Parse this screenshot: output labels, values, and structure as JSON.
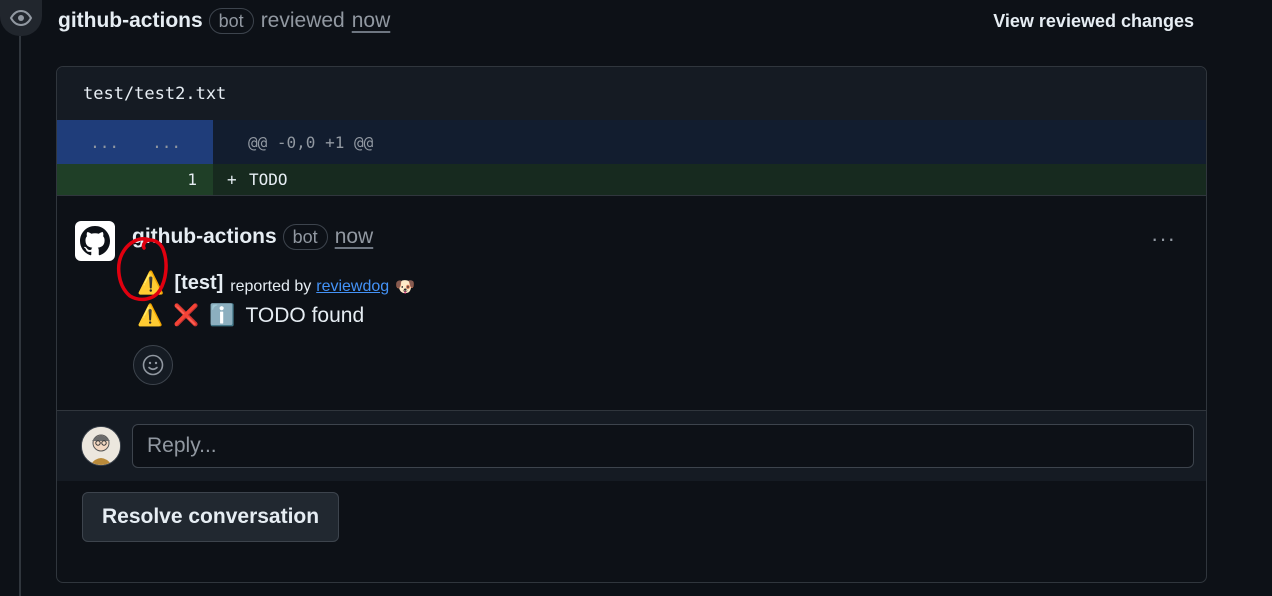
{
  "review_header": {
    "author": "github-actions",
    "badge": "bot",
    "action": "reviewed",
    "timestamp": "now",
    "view_changes_label": "View reviewed changes"
  },
  "file": {
    "path": "test/test2.txt",
    "hunk": {
      "left_num": "...",
      "right_num": "...",
      "text": "@@ -0,0 +1 @@"
    },
    "added_line": {
      "number": "1",
      "sign": "+",
      "text": "TODO"
    }
  },
  "comment": {
    "author": "github-actions",
    "badge": "bot",
    "timestamp": "now",
    "menu_label": "···",
    "tag": "[test]",
    "reported_by": "reported by",
    "link_text": "reviewdog",
    "dog_emoji": "🐶",
    "warning_emoji": "⚠️",
    "cross_emoji": "❌",
    "info_emoji": "ℹ️",
    "message": "TODO found"
  },
  "reply": {
    "placeholder": "Reply..."
  },
  "resolve_label": "Resolve conversation",
  "colors": {
    "background": "#0d1117",
    "link": "#4493f8",
    "hunk_num_bg": "#1f3d7a",
    "add_bg": "#172a1f",
    "annotation": "#e0000f"
  },
  "icons": [
    "eye-icon",
    "github-mark-icon",
    "kebab-menu-icon",
    "smiley-icon",
    "user-avatar"
  ]
}
